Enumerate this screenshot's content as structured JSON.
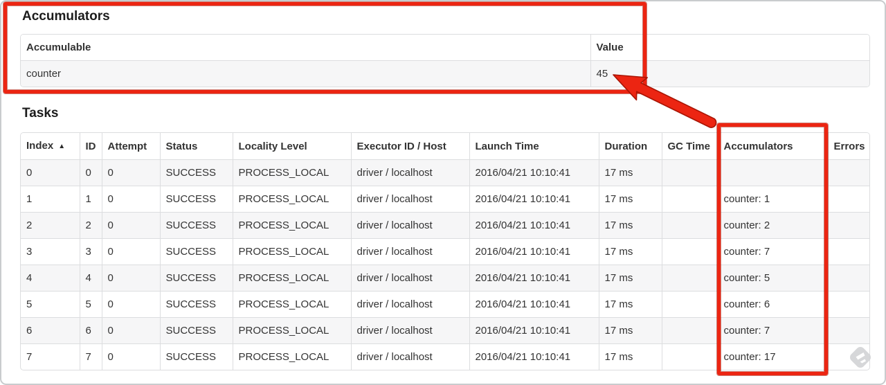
{
  "accumulators_section": {
    "title": "Accumulators",
    "table": {
      "columns": [
        "accumulable",
        "value"
      ],
      "headers": [
        "Accumulable",
        "Value"
      ],
      "rows": [
        {
          "accumulable": "counter",
          "value": "45"
        }
      ]
    }
  },
  "tasks_section": {
    "title": "Tasks",
    "table": {
      "columns": [
        "index",
        "id",
        "attempt",
        "status",
        "locality_level",
        "executor_id_host",
        "launch_time",
        "duration",
        "gc_time",
        "accumulators",
        "errors"
      ],
      "headers": [
        "Index",
        "ID",
        "Attempt",
        "Status",
        "Locality Level",
        "Executor ID / Host",
        "Launch Time",
        "Duration",
        "GC Time",
        "Accumulators",
        "Errors"
      ],
      "sort_icon": "▲",
      "rows": [
        {
          "index": "0",
          "id": "0",
          "attempt": "0",
          "status": "SUCCESS",
          "locality_level": "PROCESS_LOCAL",
          "executor_id_host": "driver / localhost",
          "launch_time": "2016/04/21 10:10:41",
          "duration": "17 ms",
          "gc_time": "",
          "accumulators": "",
          "errors": ""
        },
        {
          "index": "1",
          "id": "1",
          "attempt": "0",
          "status": "SUCCESS",
          "locality_level": "PROCESS_LOCAL",
          "executor_id_host": "driver / localhost",
          "launch_time": "2016/04/21 10:10:41",
          "duration": "17 ms",
          "gc_time": "",
          "accumulators": "counter: 1",
          "errors": ""
        },
        {
          "index": "2",
          "id": "2",
          "attempt": "0",
          "status": "SUCCESS",
          "locality_level": "PROCESS_LOCAL",
          "executor_id_host": "driver / localhost",
          "launch_time": "2016/04/21 10:10:41",
          "duration": "17 ms",
          "gc_time": "",
          "accumulators": "counter: 2",
          "errors": ""
        },
        {
          "index": "3",
          "id": "3",
          "attempt": "0",
          "status": "SUCCESS",
          "locality_level": "PROCESS_LOCAL",
          "executor_id_host": "driver / localhost",
          "launch_time": "2016/04/21 10:10:41",
          "duration": "17 ms",
          "gc_time": "",
          "accumulators": "counter: 7",
          "errors": ""
        },
        {
          "index": "4",
          "id": "4",
          "attempt": "0",
          "status": "SUCCESS",
          "locality_level": "PROCESS_LOCAL",
          "executor_id_host": "driver / localhost",
          "launch_time": "2016/04/21 10:10:41",
          "duration": "17 ms",
          "gc_time": "",
          "accumulators": "counter: 5",
          "errors": ""
        },
        {
          "index": "5",
          "id": "5",
          "attempt": "0",
          "status": "SUCCESS",
          "locality_level": "PROCESS_LOCAL",
          "executor_id_host": "driver / localhost",
          "launch_time": "2016/04/21 10:10:41",
          "duration": "17 ms",
          "gc_time": "",
          "accumulators": "counter: 6",
          "errors": ""
        },
        {
          "index": "6",
          "id": "6",
          "attempt": "0",
          "status": "SUCCESS",
          "locality_level": "PROCESS_LOCAL",
          "executor_id_host": "driver / localhost",
          "launch_time": "2016/04/21 10:10:41",
          "duration": "17 ms",
          "gc_time": "",
          "accumulators": "counter: 7",
          "errors": ""
        },
        {
          "index": "7",
          "id": "7",
          "attempt": "0",
          "status": "SUCCESS",
          "locality_level": "PROCESS_LOCAL",
          "executor_id_host": "driver / localhost",
          "launch_time": "2016/04/21 10:10:41",
          "duration": "17 ms",
          "gc_time": "",
          "accumulators": "counter: 17",
          "errors": ""
        }
      ]
    }
  },
  "annotations": {
    "highlight_color": "#ec2512",
    "watermark_icon": "skitch-logo"
  }
}
